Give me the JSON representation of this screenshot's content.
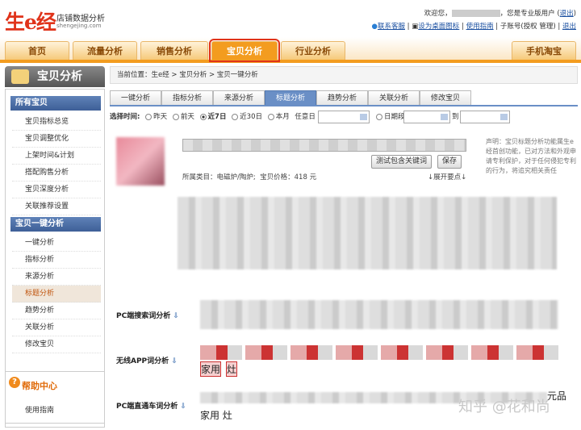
{
  "header": {
    "logo": "生e经",
    "logo_sub": "店铺数据分析",
    "logo_url": "shengejing.com",
    "welcome_prefix": "欢迎您，",
    "welcome_suffix": "，您是专业版用户 (",
    "welcome_exit": "退出",
    "welcome_close": ")",
    "links": [
      "联系客服",
      "设为桌面图标",
      "使用指南",
      "子账号(授权 管理)",
      "退出"
    ]
  },
  "nav": {
    "tabs": [
      "首页",
      "流量分析",
      "销售分析",
      "宝贝分析",
      "行业分析"
    ],
    "right": "手机淘宝",
    "active": 3
  },
  "sidebar": {
    "title": "宝贝分析",
    "sec1": "所有宝贝",
    "items1": [
      "宝贝指标总览",
      "宝贝调整优化",
      "上架时间&计划",
      "搭配购售分析",
      "宝贝深度分析",
      "关联推荐设置"
    ],
    "sec2": "宝贝一键分析",
    "items2": [
      "一键分析",
      "指标分析",
      "来源分析",
      "标题分析",
      "趋势分析",
      "关联分析",
      "修改宝贝"
    ],
    "active": "标题分析"
  },
  "help": {
    "title": "帮助中心",
    "guide": "使用指南"
  },
  "main": {
    "crumb": "当前位置：生e经 > 宝贝分析 > 宝贝一键分析",
    "tabs": [
      "一键分析",
      "指标分析",
      "来源分析",
      "标题分析",
      "趋势分析",
      "关联分析",
      "修改宝贝"
    ],
    "active_tab": "标题分析",
    "filter": {
      "label": "选择时间:",
      "options": [
        "昨天",
        "前天",
        "近7日",
        "近30日",
        "本月"
      ],
      "selected": "近7日",
      "any_day": "任意日",
      "period": "日期段",
      "to": "到"
    },
    "btn_test": "测试包含关键词",
    "btn_save": "保存",
    "category": "所属类目：电磁炉/陶炉;",
    "price": "宝贝价格：418 元",
    "expand": "↓展开要点↓",
    "notice": "声明：宝贝标题分析功能属生e经首创功能，已对方法和外观申请专利保护，对于任何侵犯专利的行为，将追究相关责任",
    "rows": [
      {
        "label": "PC端搜索词分析"
      },
      {
        "label": "无线APP词分析",
        "keywords": [
          "家用",
          "灶"
        ]
      },
      {
        "label": "PC端直通车词分析",
        "tail": "家用 灶",
        "tail2": "元品"
      }
    ]
  },
  "watermark": "知乎 @花和尚"
}
